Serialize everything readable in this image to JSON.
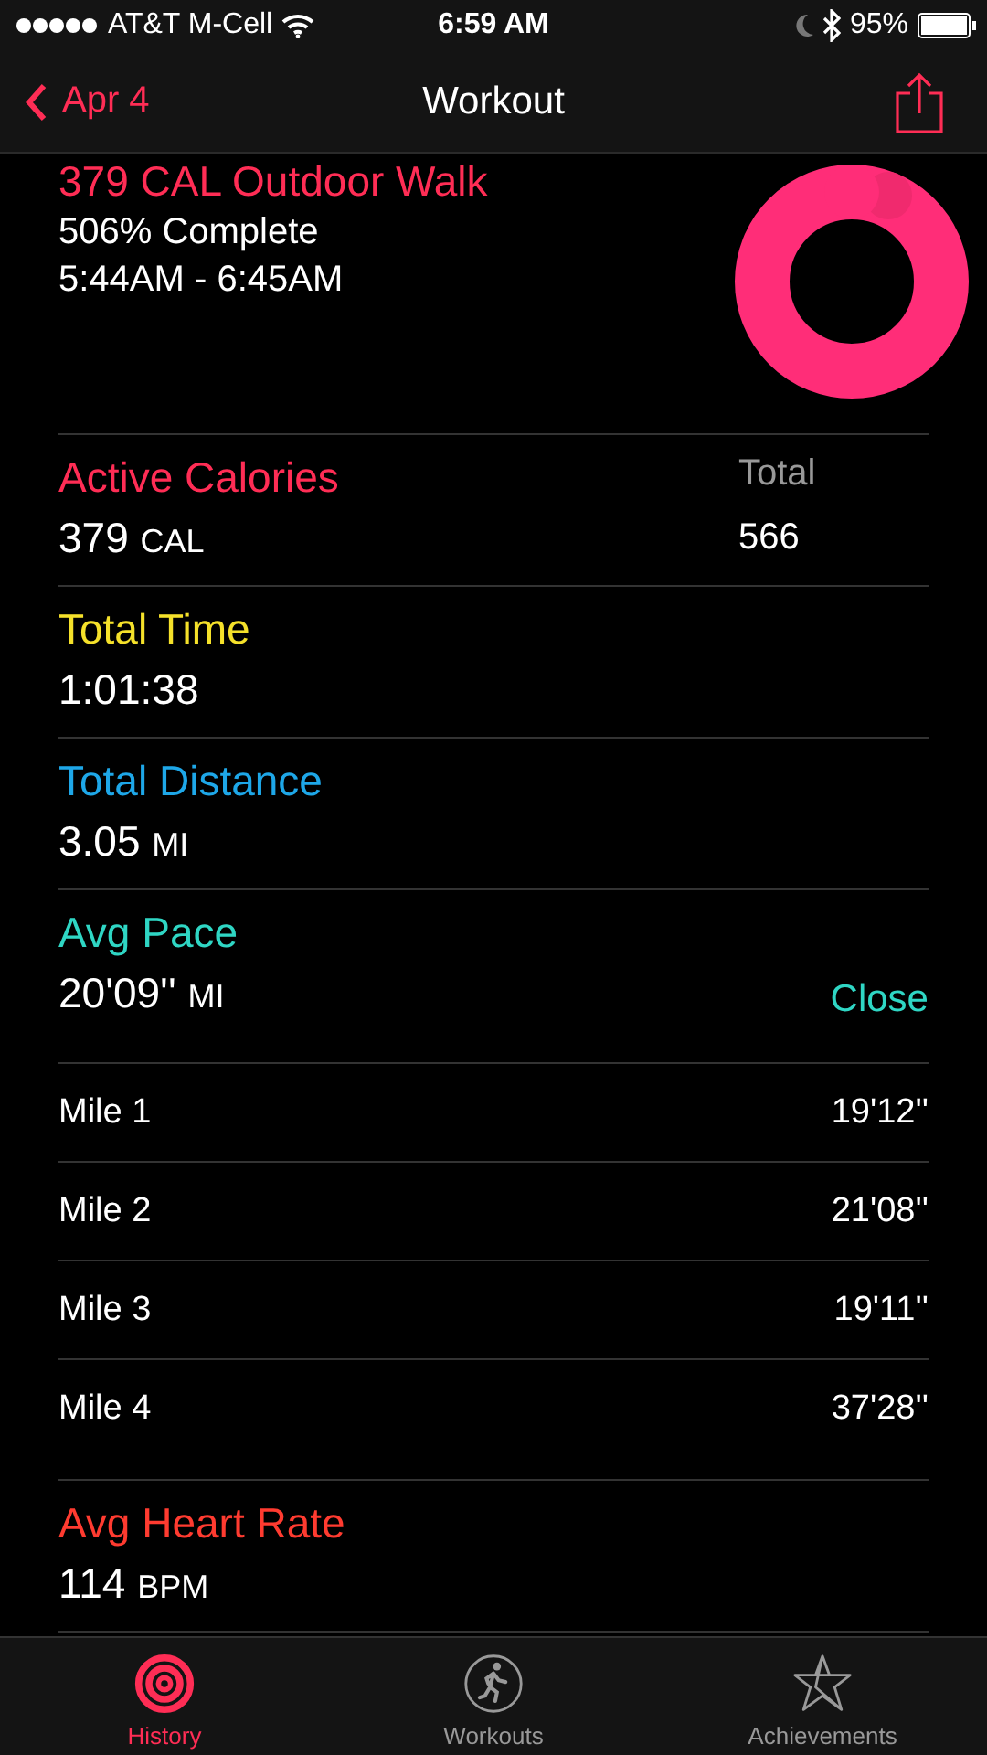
{
  "status_bar": {
    "carrier": "AT&T M-Cell",
    "time": "6:59 AM",
    "battery": "95%"
  },
  "nav": {
    "back": "Apr 4",
    "title": "Workout"
  },
  "summary": {
    "title": "379 CAL Outdoor Walk",
    "completion": "506% Complete",
    "time_range": "5:44AM - 6:45AM"
  },
  "metrics": [
    {
      "label": "Active Calories",
      "color": "#ff2d55",
      "value": "379",
      "unit": "CAL",
      "total_label": "Total",
      "total_value": "566"
    },
    {
      "label": "Total Time",
      "color": "#f5e12a",
      "value": "1:01:38"
    },
    {
      "label": "Total Distance",
      "color": "#1ea7e8",
      "value": "3.05",
      "unit": "MI"
    },
    {
      "label": "Avg Pace",
      "color": "#2fd6c4",
      "value": "20'09''",
      "unit": "MI",
      "action": "Close",
      "splits": [
        {
          "label": "Mile 1",
          "value": "19'12''"
        },
        {
          "label": "Mile 2",
          "value": "21'08''"
        },
        {
          "label": "Mile 3",
          "value": "19'11''"
        },
        {
          "label": "Mile 4",
          "value": "37'28''"
        }
      ]
    },
    {
      "label": "Avg Heart Rate",
      "color": "#ff3b30",
      "value": "114",
      "unit": "BPM"
    }
  ],
  "tabs": [
    {
      "label": "History",
      "kind": "rings",
      "selected": true
    },
    {
      "label": "Workouts",
      "kind": "runner",
      "selected": false
    },
    {
      "label": "Achievements",
      "kind": "star",
      "selected": false
    }
  ]
}
